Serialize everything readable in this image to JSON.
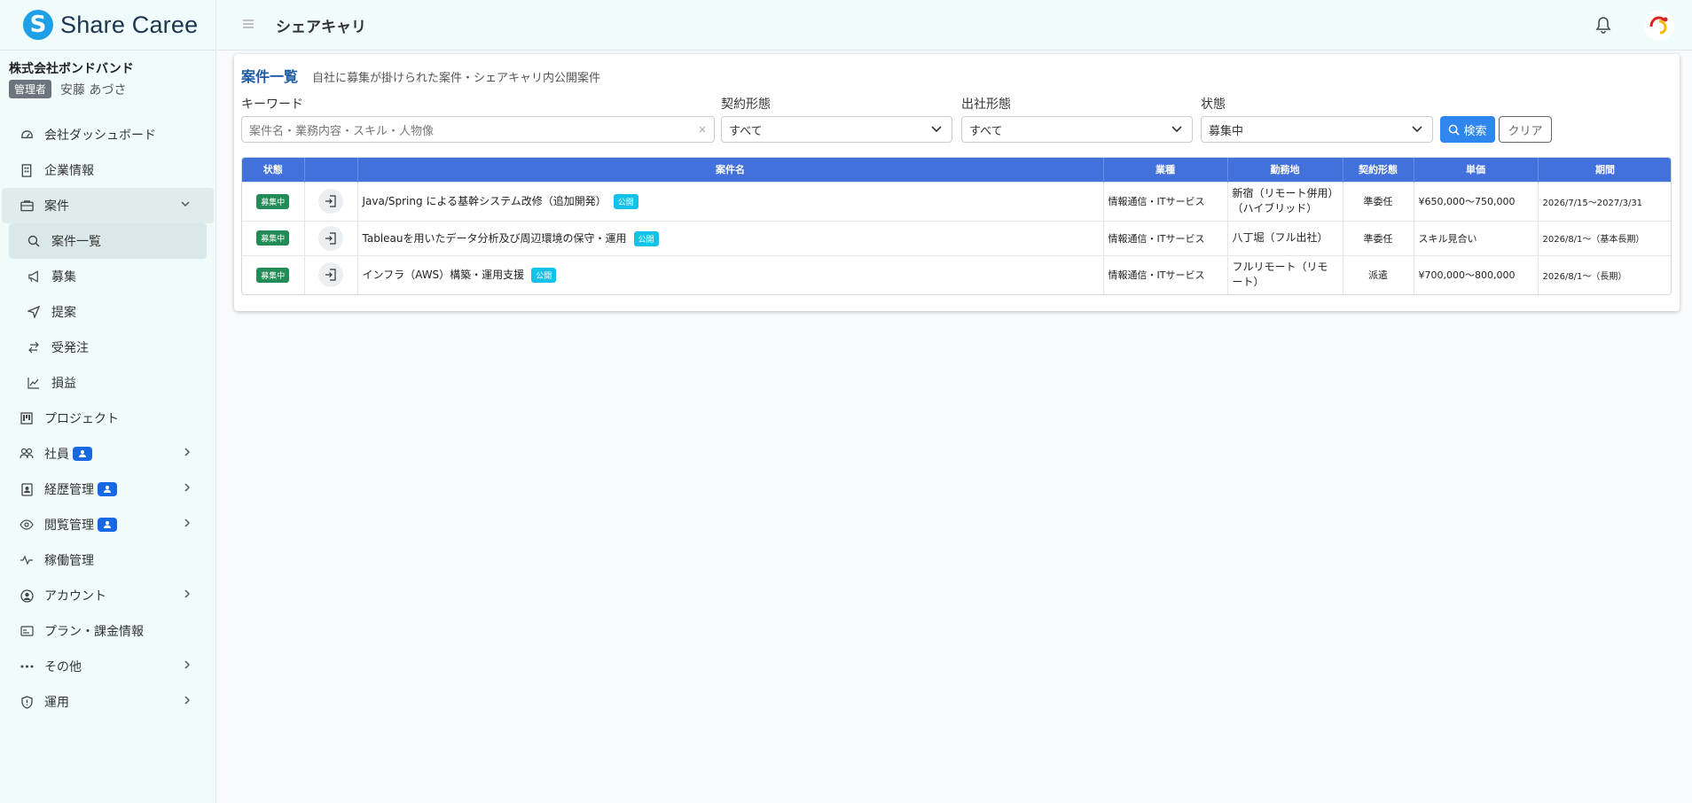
{
  "brand": {
    "name": "Share Caree",
    "mark": "S"
  },
  "company": {
    "name": "株式会社ボンドバンド",
    "role": "管理者",
    "user": "安藤 あづさ"
  },
  "sidebar": {
    "items": [
      {
        "label": "会社ダッシュボード",
        "icon": "dashboard-icon"
      },
      {
        "label": "企業情報",
        "icon": "building-icon"
      },
      {
        "label": "案件",
        "icon": "briefcase-icon"
      },
      {
        "label": "案件一覧",
        "icon": "search-icon"
      },
      {
        "label": "募集",
        "icon": "megaphone-icon"
      },
      {
        "label": "提案",
        "icon": "send-icon"
      },
      {
        "label": "受発注",
        "icon": "swap-icon"
      },
      {
        "label": "損益",
        "icon": "chart-line-icon"
      },
      {
        "label": "プロジェクト",
        "icon": "kanban-icon"
      },
      {
        "label": "社員",
        "icon": "people-icon"
      },
      {
        "label": "経歴管理",
        "icon": "person-badge-icon"
      },
      {
        "label": "閲覧管理",
        "icon": "eye-icon"
      },
      {
        "label": "稼働管理",
        "icon": "activity-icon"
      },
      {
        "label": "アカウント",
        "icon": "person-circle-icon"
      },
      {
        "label": "プラン・課金情報",
        "icon": "card-icon"
      },
      {
        "label": "その他",
        "icon": "dots-icon"
      },
      {
        "label": "運用",
        "icon": "shield-icon"
      }
    ]
  },
  "header": {
    "title": "シェアキャリ"
  },
  "page": {
    "title": "案件一覧",
    "subtitle": "自社に募集が掛けられた案件・シェアキャリ内公開案件"
  },
  "filters": {
    "keyword": {
      "label": "キーワード",
      "placeholder": "案件名・業務内容・スキル・人物像",
      "clear": "×"
    },
    "contract": {
      "label": "契約形態",
      "value": "すべて"
    },
    "attendance": {
      "label": "出社形態",
      "value": "すべて"
    },
    "status": {
      "label": "状態",
      "value": "募集中"
    },
    "search_label": "検索",
    "clear_label": "クリア"
  },
  "table": {
    "headers": [
      "状態",
      "",
      "案件名",
      "業種",
      "勤務地",
      "契約形態",
      "単価",
      "期間"
    ],
    "rows": [
      {
        "status": "募集中",
        "title": "Java/Spring による基幹システム改修（追加開発）",
        "badge": "公開",
        "industry": "情報通信・ITサービス",
        "location": "新宿（リモート併用）（ハイブリッド）",
        "contract": "準委任",
        "price": "¥650,000〜750,000",
        "period": "2026/7/15〜2027/3/31"
      },
      {
        "status": "募集中",
        "title": "Tableauを用いたデータ分析及び周辺環境の保守・運用",
        "badge": "公開",
        "industry": "情報通信・ITサービス",
        "location": "八丁堀（フル出社）",
        "contract": "準委任",
        "price": "スキル見合い",
        "period": "2026/8/1〜（基本長期）"
      },
      {
        "status": "募集中",
        "title": "インフラ（AWS）構築・運用支援",
        "badge": "公開",
        "industry": "情報通信・ITサービス",
        "location": "フルリモート（リモート）",
        "contract": "派遣",
        "price": "¥700,000〜800,000",
        "period": "2026/8/1〜（長期）"
      }
    ]
  },
  "colors": {
    "accent": "#4371dc",
    "status": "#238c56",
    "public": "#13c2e8",
    "search": "#2f86ee"
  }
}
